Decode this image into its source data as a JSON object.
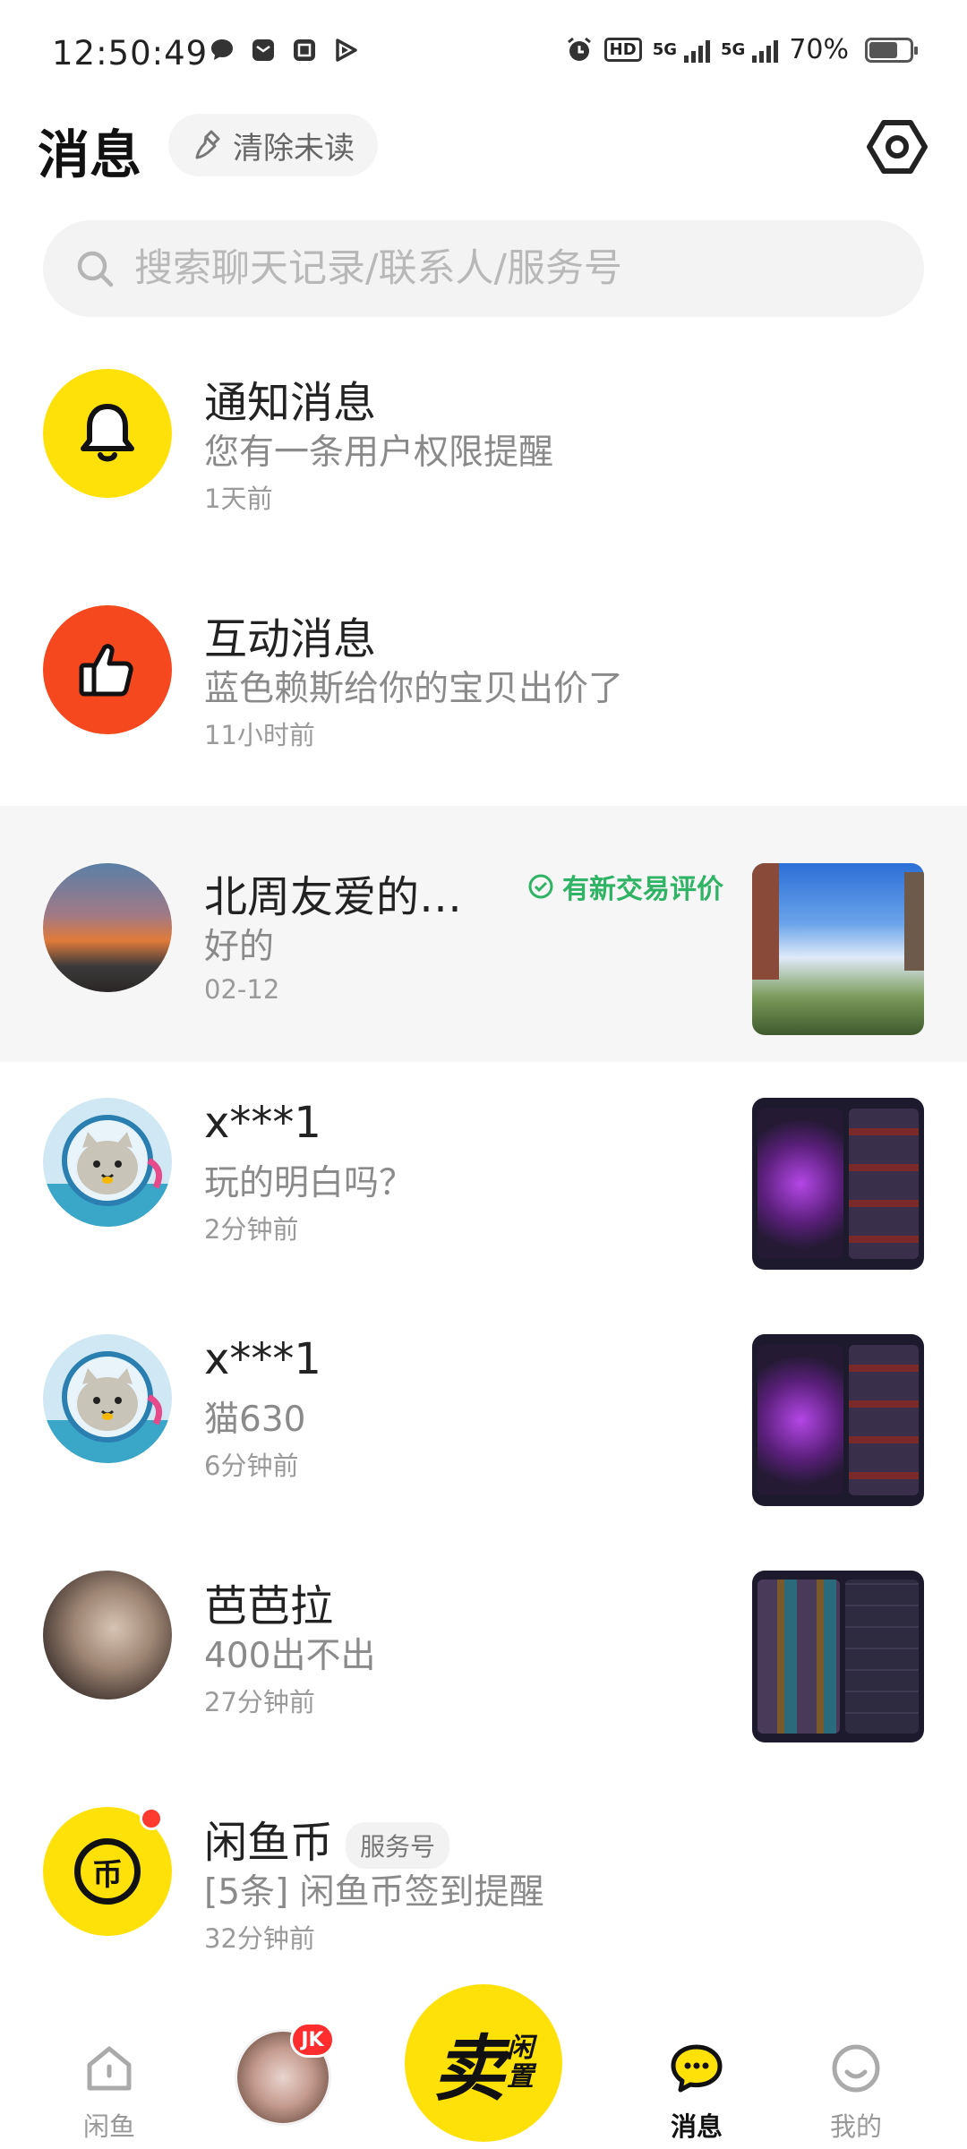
{
  "status_bar": {
    "time": "12:50:49",
    "battery": "70%",
    "battery_level": 0.7,
    "net1": "5G",
    "net2": "5G",
    "hd": "HD"
  },
  "header": {
    "title": "消息",
    "clear_label": "清除未读"
  },
  "search": {
    "placeholder": "搜索聊天记录/联系人/服务号"
  },
  "messages": [
    {
      "title": "通知消息",
      "subtitle": "您有一条用户权限提醒",
      "time": "1天前"
    },
    {
      "title": "互动消息",
      "subtitle": "蓝色赖斯给你的宝贝出价了",
      "time": "11小时前"
    },
    {
      "title": "北周友爱的…",
      "subtitle": "好的",
      "time": "02-12",
      "badge": "有新交易评价"
    },
    {
      "title": "x***1",
      "subtitle": "玩的明白吗？",
      "time": "2分钟前"
    },
    {
      "title": "x***1",
      "subtitle": "猫630",
      "time": "6分钟前"
    },
    {
      "title": "芭芭拉",
      "subtitle": "400出不出",
      "time": "27分钟前"
    },
    {
      "title": "闲鱼币",
      "tag": "服务号",
      "subtitle": "[5条] 闲鱼币签到提醒",
      "time": "32分钟前"
    }
  ],
  "tabbar": {
    "home_label": "闲鱼",
    "sell_big": "卖",
    "sell_small_1": "闲",
    "sell_small_2": "置",
    "jk_badge": "JK",
    "messages_label": "消息",
    "profile_label": "我的"
  },
  "coin_icon_text": "币",
  "colors": {
    "accent_yellow": "#FFE10A",
    "interaction_red": "#F5481F",
    "review_green": "#2FB364"
  }
}
